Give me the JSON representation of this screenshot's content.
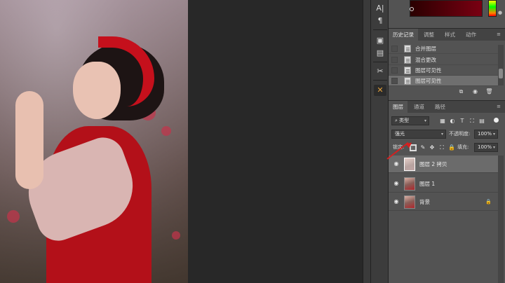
{
  "history": {
    "tabs": [
      "历史记录",
      "调整",
      "样式",
      "动作"
    ],
    "items": [
      {
        "label": "合并图层",
        "selected": false
      },
      {
        "label": "混合更改",
        "selected": false
      },
      {
        "label": "图层可见性",
        "selected": false
      },
      {
        "label": "图层可见性",
        "selected": true
      }
    ]
  },
  "layers_panel": {
    "tabs": [
      "图层",
      "通道",
      "路径"
    ],
    "filter_label": "类型",
    "blend_mode": "强光",
    "opacity_label": "不透明度:",
    "opacity_value": "100%",
    "lock_label": "锁定:",
    "fill_label": "填充:",
    "fill_value": "100%",
    "layers": [
      {
        "name": "图层 2 拷贝",
        "selected": true,
        "visible": true,
        "locked": false
      },
      {
        "name": "图层 1",
        "selected": false,
        "visible": true,
        "locked": false
      },
      {
        "name": "背景",
        "selected": false,
        "visible": true,
        "locked": true
      }
    ]
  },
  "colors": {
    "panel_bg": "#535353",
    "selected_row": "#6b6b6b",
    "annotation_arrow": "#d42020",
    "active_tool": "#e6a23c"
  },
  "tools": [
    {
      "icon": "character-icon",
      "glyph": "A|"
    },
    {
      "icon": "paragraph-icon",
      "glyph": "¶"
    },
    {
      "icon": "library-icon",
      "glyph": "▣"
    },
    {
      "icon": "notes-icon",
      "glyph": "▤"
    },
    {
      "icon": "tool-presets-icon",
      "glyph": "✂"
    },
    {
      "icon": "brush-settings-icon",
      "glyph": "✕"
    }
  ]
}
